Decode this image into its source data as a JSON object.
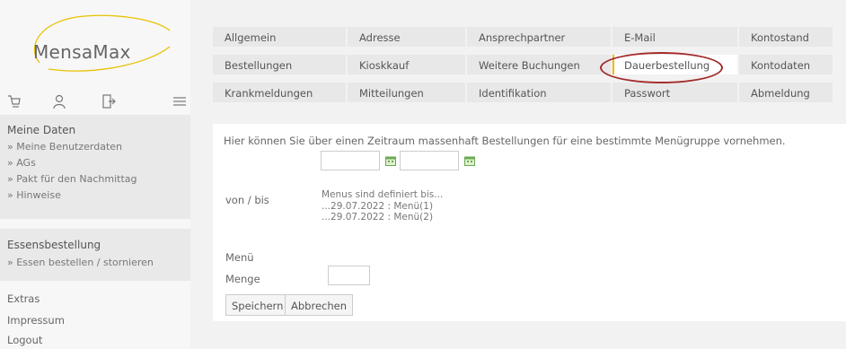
{
  "app": {
    "logo_text": "MensaMax"
  },
  "sidebar": {
    "icons": [
      "cart-icon",
      "user-icon",
      "logout-icon",
      "menu-icon"
    ],
    "sections": [
      {
        "title": "Meine Daten",
        "items": [
          "» Meine Benutzerdaten",
          "» AGs",
          "» Pakt für den Nachmittag",
          "» Hinweise"
        ]
      },
      {
        "title": "Essensbestellung",
        "items": [
          "» Essen bestellen / stornieren"
        ]
      }
    ],
    "links": [
      "Extras",
      "Impressum",
      "Logout"
    ]
  },
  "tabs": {
    "row1": [
      "Allgemein",
      "Adresse",
      "Ansprechpartner",
      "E-Mail",
      "Kontostand"
    ],
    "row2": [
      "Bestellungen",
      "Kioskkauf",
      "Weitere Buchungen",
      "Dauerbestellung",
      "Kontodaten"
    ],
    "row3": [
      "Krankmeldungen",
      "Mitteilungen",
      "Identifikation",
      "Passwort",
      "Abmeldung"
    ],
    "active": "Dauerbestellung"
  },
  "form": {
    "intro": "Hier können Sie über einen Zeitraum massenhaft Bestellungen für eine bestimmte Menügruppe vornehmen.",
    "von_bis_label": "von / bis",
    "menus_title": "Menus sind definiert bis...",
    "menus": [
      "...29.07.2022 : Menü(1)",
      "...29.07.2022 : Menü(2)"
    ],
    "menu_label": "Menü",
    "menge_label": "Menge",
    "save_label": "Speichern",
    "cancel_label": "Abbrechen"
  },
  "colors": {
    "highlight": "#a52b2b",
    "active_marker": "#f2b800",
    "logo_swoosh": "#e8c200"
  }
}
